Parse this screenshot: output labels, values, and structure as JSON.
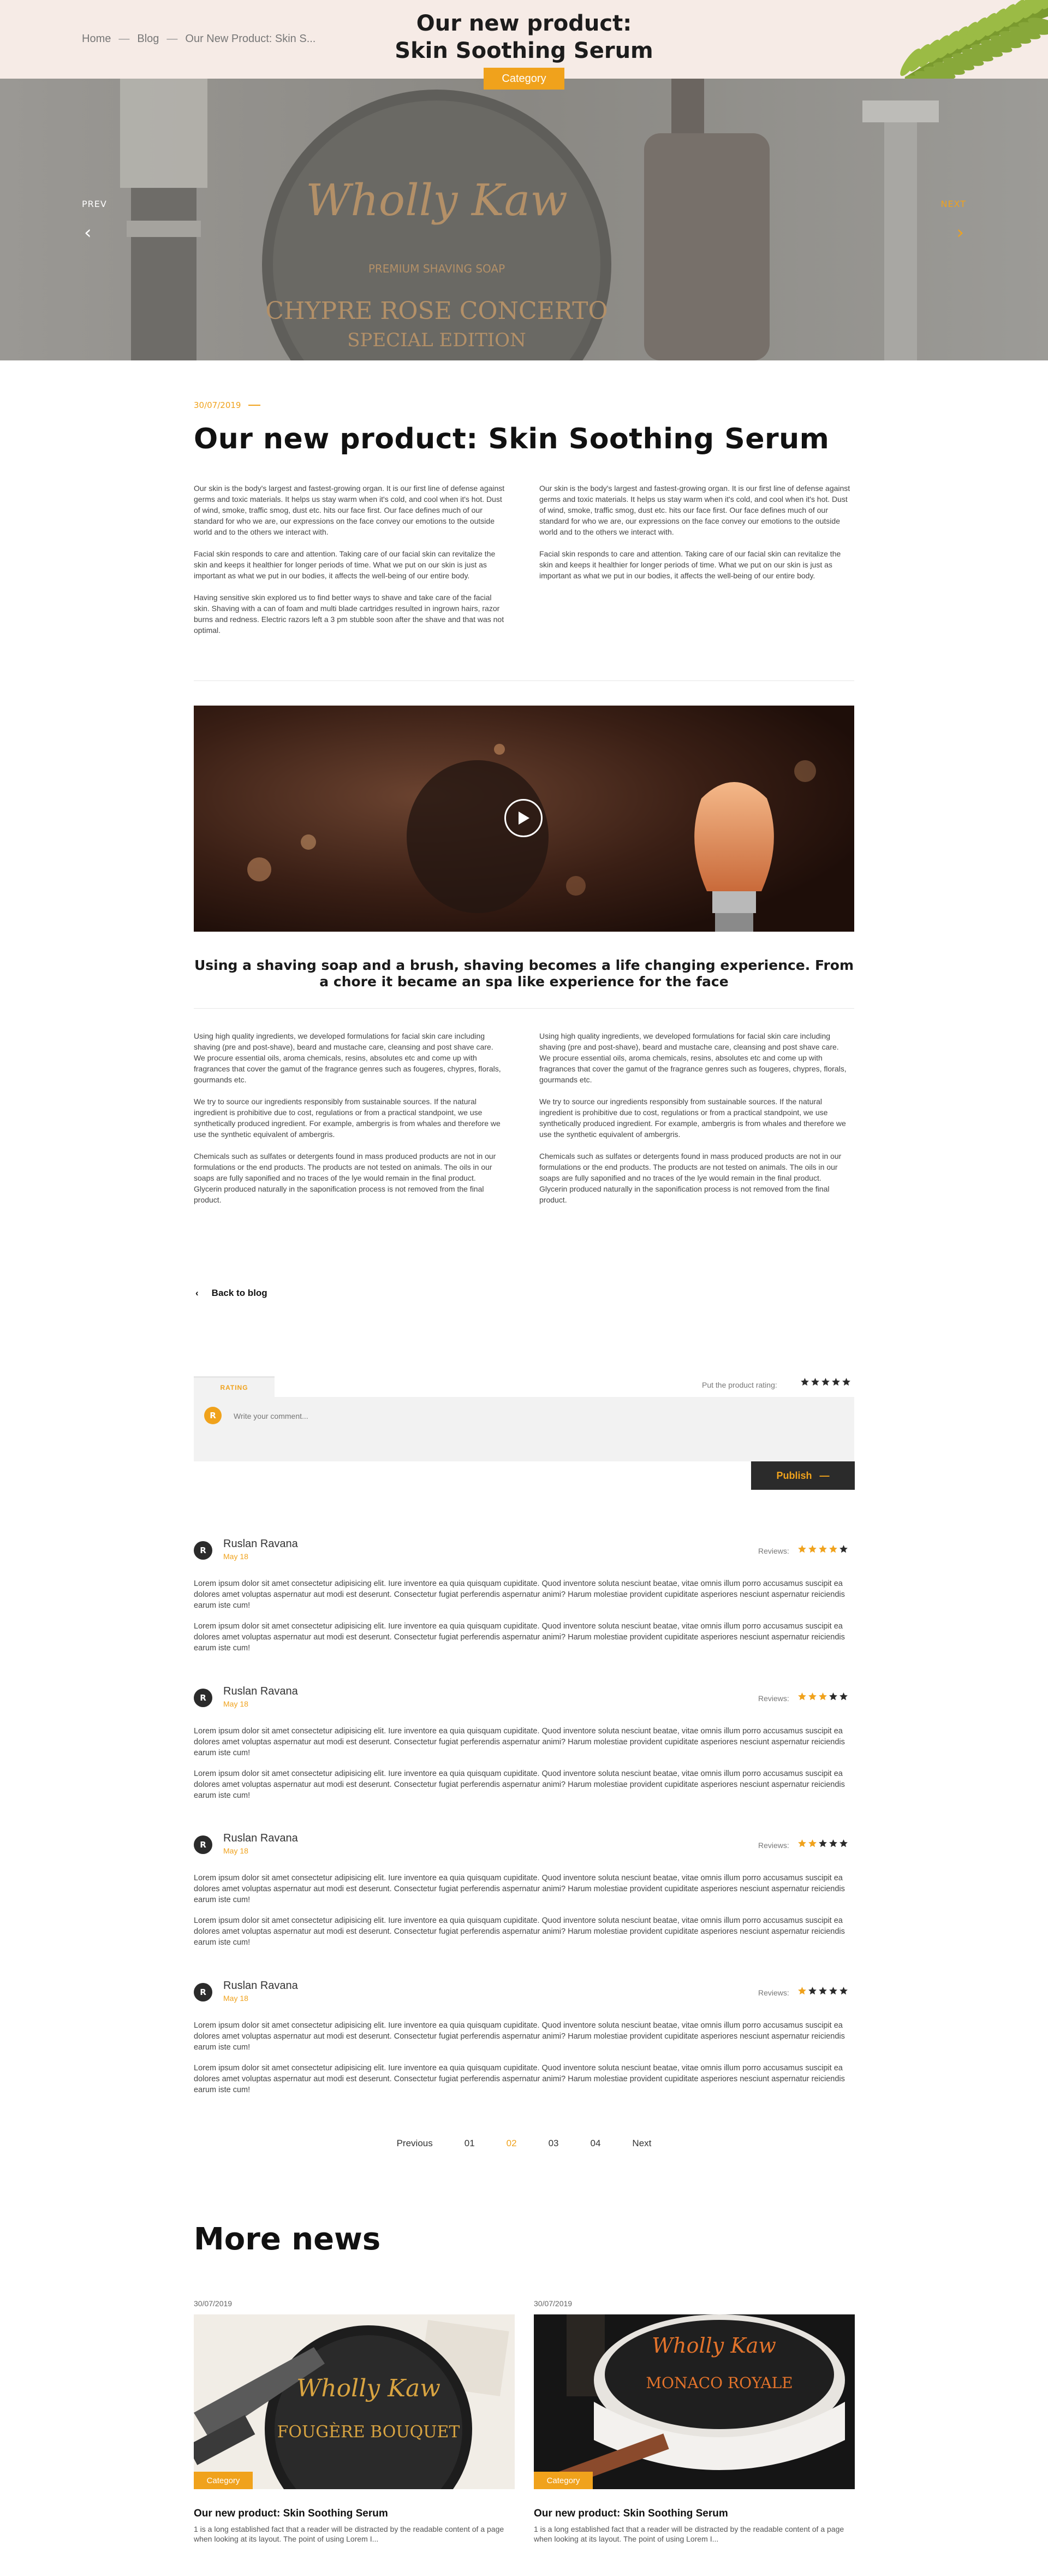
{
  "breadcrumb": {
    "home": "Home",
    "blog": "Blog",
    "current": "Our New Product: Skin S...",
    "separator": "—"
  },
  "header": {
    "title_line1": "Our new product:",
    "title_line2": "Skin Soothing Serum",
    "category": "Category"
  },
  "hero": {
    "prev": "PREV",
    "next": "NEXT",
    "product_brand": "Wholly Kaw",
    "product_name": "CHYPRE ROSE CONCERTO",
    "product_edition": "SPECIAL EDITION",
    "product_type": "PREMIUM SHAVING SOAP"
  },
  "article": {
    "date": "30/07/2019",
    "title": "Our new product: Skin Soothing Serum",
    "col1": [
      "Our skin is the body's largest and fastest-growing organ. It is our first line of defense against germs and toxic materials. It helps us stay warm when it's cold, and cool when it's hot. Dust of wind, smoke, traffic smog, dust etc. hits our face first. Our face defines much of our standard for who we are, our expressions on the face convey our emotions to the outside world and to the others we interact with.",
      "Facial skin responds to care and attention. Taking care of our facial skin can revitalize the skin and keeps it healthier for longer periods of time. What we put on our skin is just as important as what we put in our bodies, it affects the well-being of our entire body.",
      "Having sensitive skin explored us to find better ways to shave and take care of the facial skin. Shaving with a can of foam and multi blade cartridges resulted in ingrown hairs, razor burns and redness. Electric razors left a 3 pm stubble soon after the shave and that was not optimal."
    ],
    "col2": [
      "Our skin is the body's largest and fastest-growing organ. It is our first line of defense against germs and toxic materials. It helps us stay warm when it's cold, and cool when it's hot. Dust of wind, smoke, traffic smog, dust etc. hits our face first. Our face defines much of our standard for who we are, our expressions on the face convey our emotions to the outside world and to the others we interact with.",
      "Facial skin responds to care and attention. Taking care of our facial skin can revitalize the skin and keeps it healthier for longer periods of time. What we put on our skin is just as important as what we put in our bodies, it affects the well-being of our entire body."
    ],
    "quote": "Using a shaving soap and a brush, shaving becomes a life changing experience. From a chore it became an spa like experience for the face",
    "col3": [
      "Using high quality ingredients, we developed formulations for facial skin care including shaving (pre and post-shave), beard and mustache care, cleansing and post shave care. We procure essential oils, aroma chemicals, resins, absolutes etc and come up with fragrances that cover the gamut of the fragrance genres such as fougeres, chypres, florals, gourmands etc.",
      "We try to source our ingredients responsibly from sustainable sources. If the natural ingredient is prohibitive due to cost, regulations or from a practical standpoint, we use synthetically produced ingredient. For example, ambergris is from whales and therefore we use the synthetic equivalent of ambergris.",
      "Chemicals such as sulfates or detergents found in mass produced products are not in our formulations or the end products. The products are not tested on animals. The oils in our soaps are fully saponified and no traces of the lye would remain in the final product. Glycerin produced naturally in the saponification process is not removed from the final product."
    ],
    "col4": [
      "Using high quality ingredients, we developed formulations for facial skin care including shaving (pre and post-shave), beard and mustache care, cleansing and post shave care. We procure essential oils, aroma chemicals, resins, absolutes etc and come up with fragrances that cover the gamut of the fragrance genres such as fougeres, chypres, florals, gourmands etc.",
      "We try to source our ingredients responsibly from sustainable sources. If the natural ingredient is prohibitive due to cost, regulations or from a practical standpoint, we use synthetically produced ingredient. For example, ambergris is from whales and therefore we use the synthetic equivalent of ambergris.",
      "Chemicals such as sulfates or detergents found in mass produced products are not in our formulations or the end products. The products are not tested on animals. The oils in our soaps are fully saponified and no traces of the lye would remain in the final product. Glycerin produced naturally in the saponification process is not removed from the final product."
    ],
    "back": "Back to blog"
  },
  "comment_form": {
    "tab": "RATING",
    "rate_prompt": "Put the product rating:",
    "avatar_letter": "R",
    "placeholder": "Write your comment...",
    "publish": "Publish",
    "publish_arrow": "—",
    "rating_value": 0
  },
  "reviews": {
    "label": "Reviews:",
    "items": [
      {
        "avatar": "R",
        "name": "Ruslan Ravana",
        "date": "May 18",
        "rating": 4,
        "p1": "Lorem ipsum dolor sit amet consectetur adipisicing elit. Iure inventore ea quia quisquam cupiditate. Quod inventore soluta nesciunt beatae, vitae omnis illum porro accusamus suscipit ea dolores amet voluptas aspernatur aut modi est deserunt. Consectetur fugiat perferendis aspernatur animi? Harum molestiae provident cupiditate asperiores nesciunt aspernatur reiciendis earum iste cum!",
        "p2": "Lorem ipsum dolor sit amet consectetur adipisicing elit. Iure inventore ea quia quisquam cupiditate. Quod inventore soluta nesciunt beatae, vitae omnis illum porro accusamus suscipit ea dolores amet voluptas aspernatur aut modi est deserunt. Consectetur fugiat perferendis aspernatur animi? Harum molestiae provident cupiditate asperiores nesciunt aspernatur reiciendis earum iste cum!"
      },
      {
        "avatar": "R",
        "name": "Ruslan Ravana",
        "date": "May 18",
        "rating": 3,
        "p1": "Lorem ipsum dolor sit amet consectetur adipisicing elit. Iure inventore ea quia quisquam cupiditate. Quod inventore soluta nesciunt beatae, vitae omnis illum porro accusamus suscipit ea dolores amet voluptas aspernatur aut modi est deserunt. Consectetur fugiat perferendis aspernatur animi? Harum molestiae provident cupiditate asperiores nesciunt aspernatur reiciendis earum iste cum!",
        "p2": "Lorem ipsum dolor sit amet consectetur adipisicing elit. Iure inventore ea quia quisquam cupiditate. Quod inventore soluta nesciunt beatae, vitae omnis illum porro accusamus suscipit ea dolores amet voluptas aspernatur aut modi est deserunt. Consectetur fugiat perferendis aspernatur animi? Harum molestiae provident cupiditate asperiores nesciunt aspernatur reiciendis earum iste cum!"
      },
      {
        "avatar": "R",
        "name": "Ruslan Ravana",
        "date": "May 18",
        "rating": 2,
        "p1": "Lorem ipsum dolor sit amet consectetur adipisicing elit. Iure inventore ea quia quisquam cupiditate. Quod inventore soluta nesciunt beatae, vitae omnis illum porro accusamus suscipit ea dolores amet voluptas aspernatur aut modi est deserunt. Consectetur fugiat perferendis aspernatur animi? Harum molestiae provident cupiditate asperiores nesciunt aspernatur reiciendis earum iste cum!",
        "p2": "Lorem ipsum dolor sit amet consectetur adipisicing elit. Iure inventore ea quia quisquam cupiditate. Quod inventore soluta nesciunt beatae, vitae omnis illum porro accusamus suscipit ea dolores amet voluptas aspernatur aut modi est deserunt. Consectetur fugiat perferendis aspernatur animi? Harum molestiae provident cupiditate asperiores nesciunt aspernatur reiciendis earum iste cum!"
      },
      {
        "avatar": "R",
        "name": "Ruslan Ravana",
        "date": "May 18",
        "rating": 1,
        "p1": "Lorem ipsum dolor sit amet consectetur adipisicing elit. Iure inventore ea quia quisquam cupiditate. Quod inventore soluta nesciunt beatae, vitae omnis illum porro accusamus suscipit ea dolores amet voluptas aspernatur aut modi est deserunt. Consectetur fugiat perferendis aspernatur animi? Harum molestiae provident cupiditate asperiores nesciunt aspernatur reiciendis earum iste cum!",
        "p2": "Lorem ipsum dolor sit amet consectetur adipisicing elit. Iure inventore ea quia quisquam cupiditate. Quod inventore soluta nesciunt beatae, vitae omnis illum porro accusamus suscipit ea dolores amet voluptas aspernatur aut modi est deserunt. Consectetur fugiat perferendis aspernatur animi? Harum molestiae provident cupiditate asperiores nesciunt aspernatur reiciendis earum iste cum!"
      }
    ]
  },
  "pagination": {
    "previous": "Previous",
    "pages": [
      "01",
      "02",
      "03",
      "04"
    ],
    "active": "02",
    "next": "Next"
  },
  "more_news": {
    "title": "More news",
    "cards": [
      {
        "date": "30/07/2019",
        "category": "Category",
        "title": "Our new product: Skin Soothing Serum",
        "desc": "1 is a long established fact that a reader will be distracted by the readable content of a page when looking at its layout. The point of using Lorem I...",
        "product_brand": "Wholly Kaw",
        "product_name": "FOUGÈRE BOUQUET"
      },
      {
        "date": "30/07/2019",
        "category": "Category",
        "title": "Our new product: Skin Soothing Serum",
        "desc": "1 is a long established fact that a reader will be distracted by the readable content of a page when looking at its layout. The point of using Lorem I...",
        "product_brand": "Wholly Kaw",
        "product_name": "MONACO ROYALE"
      }
    ]
  },
  "colors": {
    "accent": "#f0a21c",
    "band": "#f6ebe6",
    "dark": "#2b2b2b",
    "star_inactive": "#2b2b2b"
  }
}
